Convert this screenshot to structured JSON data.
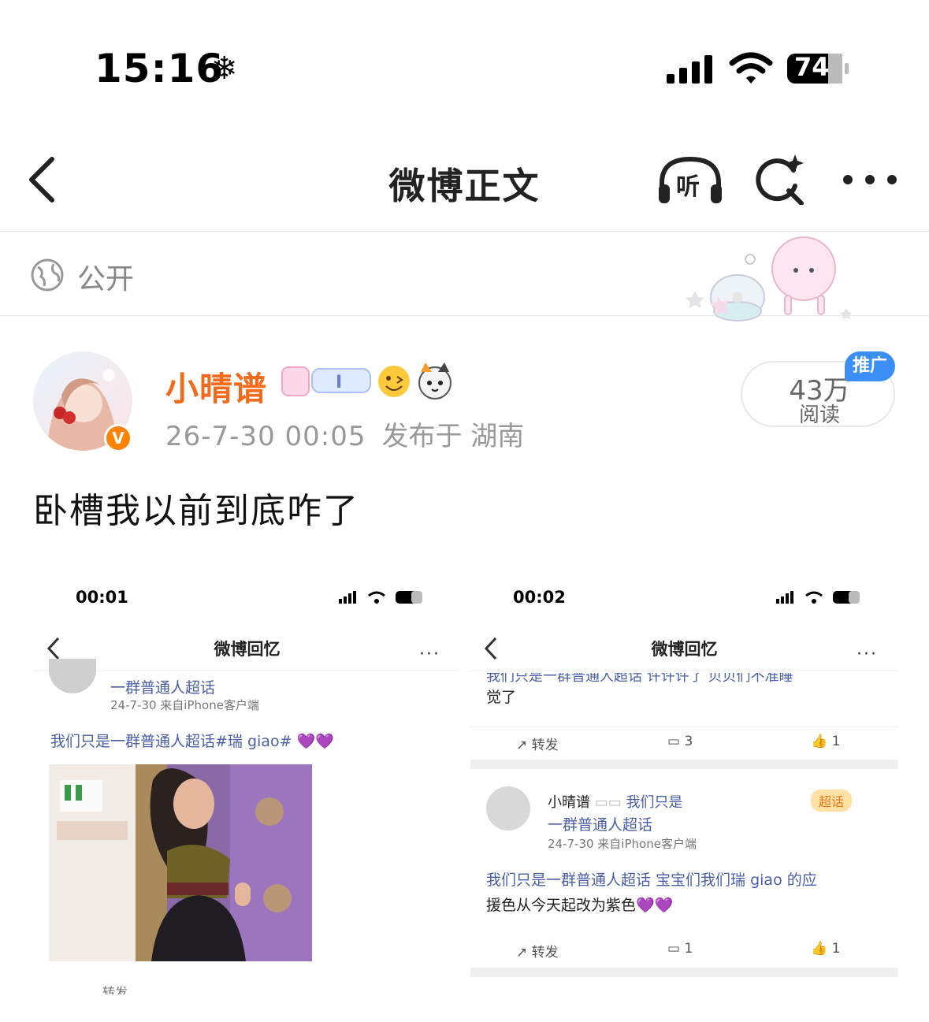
{
  "status_bar": {
    "time": "15:16",
    "weather_icon": "snowflake-icon",
    "battery": "74"
  },
  "nav": {
    "title": "微博正文",
    "listen_label": "听"
  },
  "visibility": {
    "label": "公开"
  },
  "author": {
    "name": "小晴谱",
    "time": "26-7-30 00:05",
    "location": "发布于 湖南",
    "verified_badge": "V"
  },
  "reads": {
    "count": "43万",
    "label": "阅读",
    "promo_badge": "推广"
  },
  "post": {
    "text": "卧槽我以前到底咋了"
  },
  "shot1": {
    "time": "00:01",
    "title": "微博回忆",
    "line1": "一群普通人超话",
    "line2": "24-7-30  来自iPhone客户端",
    "line3": "我们只是一群普通人超话#瑞 giao# 💜💜",
    "bottom_partial": "转发"
  },
  "shot2": {
    "time": "00:02",
    "title": "微博回忆",
    "top_partial": "我们只是一群普通人超话 许许许了 贝贝们不准睡",
    "top_line2": "觉了",
    "actions1": {
      "repost": "转发",
      "comments": "3",
      "likes": "1"
    },
    "user_name": "小晴谱",
    "user_topic": "我们只是",
    "user_topic2": "一群普通人超话",
    "user_meta": "24-7-30  来自iPhone客户端",
    "chip": "超话",
    "body1": "我们只是一群普通人超话 宝宝们我们瑞 giao 的应",
    "body2": "援色从今天起改为紫色💜💜",
    "actions2": {
      "repost": "转发",
      "comments": "1",
      "likes": "1"
    }
  },
  "colors": {
    "name_orange": "#f26b1d",
    "promo_blue": "#3a8ef6",
    "verified_orange": "#ff8200"
  }
}
